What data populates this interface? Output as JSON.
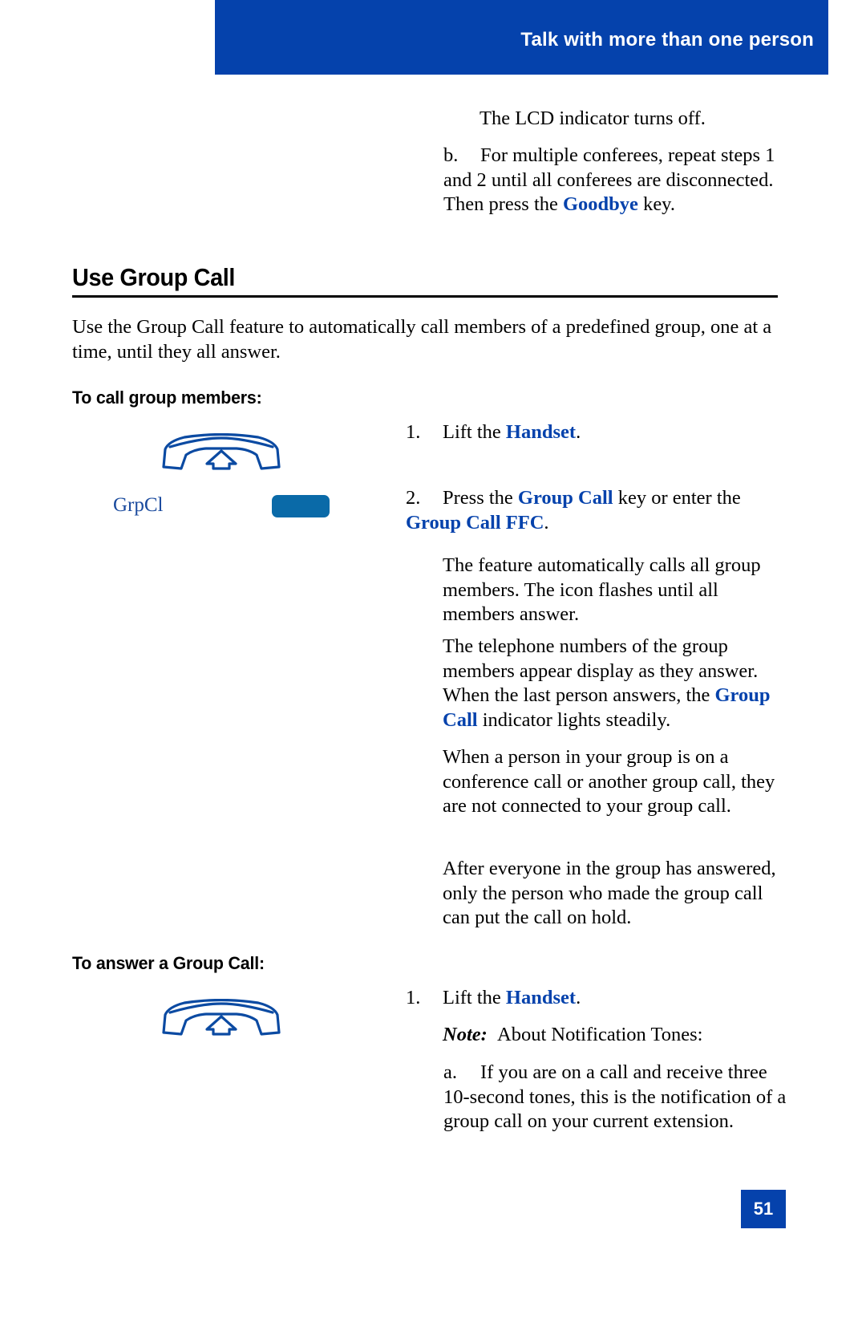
{
  "header": {
    "title": "Talk with more than one person",
    "bar_color": "#0542ac"
  },
  "top_continuation": {
    "lcd_line": "The LCD indicator turns off.",
    "item_b": {
      "marker": "b.",
      "text_before": "For multiple conferees, repeat steps 1 and 2 until all conferees are disconnected. Then press the ",
      "key": "Goodbye",
      "text_after": " key."
    }
  },
  "section": {
    "heading": "Use Group Call",
    "intro": "Use the Group Call feature to automatically call members of a predefined group, one at a time, until they all answer."
  },
  "to_call": {
    "sub_heading": "To call group members:",
    "icon_name": "lift-handset-icon",
    "key_label": "GrpCl",
    "key_button_color": "#0a6aa8",
    "steps": [
      {
        "marker": "1.",
        "text_before": "Lift the ",
        "key": "Handset",
        "text_after": "."
      },
      {
        "marker": "2.",
        "text_before": "Press the ",
        "key": "Group Call",
        "text_mid": " key or enter the ",
        "key2": "Group Call FFC",
        "text_after": "."
      }
    ],
    "paragraphs": [
      "The feature automatically calls all group members. The icon flashes until all members answer.",
      {
        "before": "The telephone numbers of the group members appear display as they answer. When the last person answers, the ",
        "key": "Group Call",
        "after": " indicator lights steadily."
      },
      "When a person in your group is on a conference call or another group call, they are not connected to your group call.",
      "After everyone in the group has answered, only the person who made the group call can put the call on hold."
    ]
  },
  "to_answer": {
    "sub_heading": "To answer a Group Call:",
    "icon_name": "lift-handset-icon",
    "step": {
      "marker": "1.",
      "text_before": "Lift the ",
      "key": "Handset",
      "text_after": "."
    },
    "note_label": "Note:",
    "note_text": "About Notification Tones:",
    "sub_items": [
      {
        "marker": "a.",
        "text": "If you are on a call and receive three 10-second tones, this is the notification of a group call on your current extension."
      }
    ]
  },
  "footer": {
    "page_number": "51",
    "box_color": "#0542ac"
  },
  "colors": {
    "accent_blue": "#0542ac",
    "key_label_blue": "#1b4b9e",
    "button_blue": "#0a6aa8"
  }
}
